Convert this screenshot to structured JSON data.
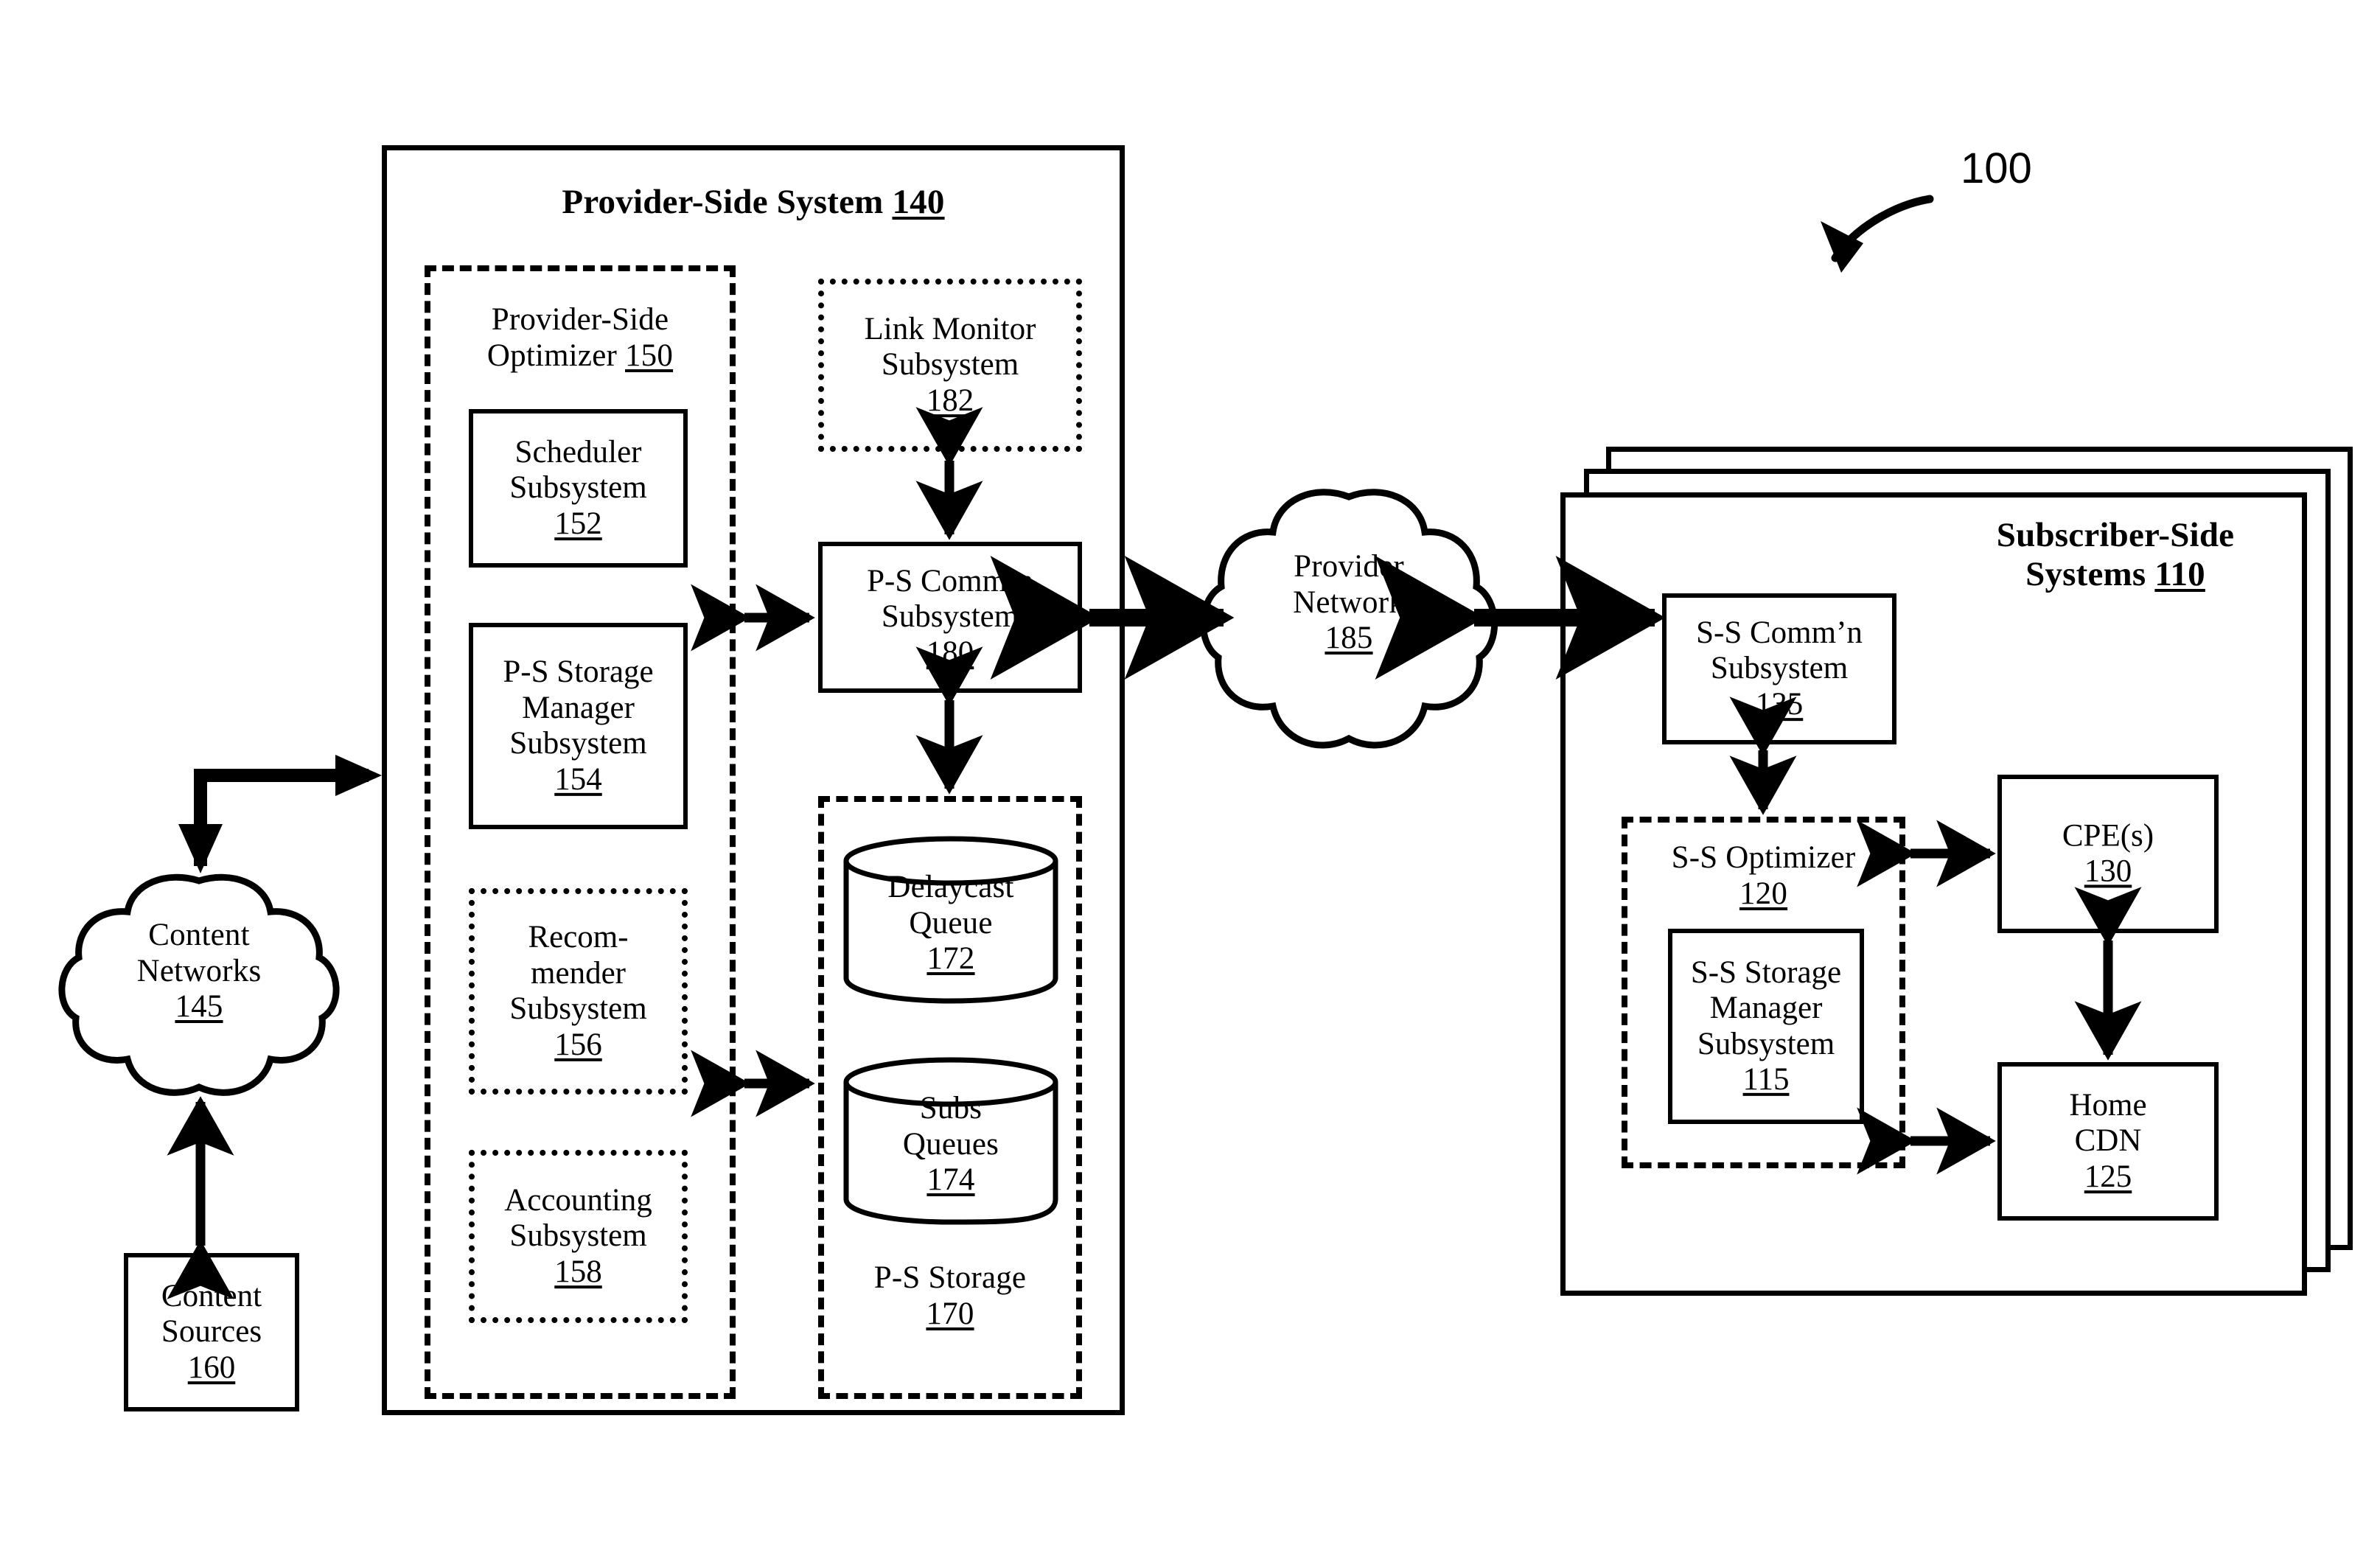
{
  "figure": {
    "reference_number": "100"
  },
  "provider_side_system": {
    "title": "Provider-Side System",
    "ref": "140",
    "optimizer": {
      "title_line1": "Provider-Side",
      "title_line2": "Optimizer",
      "ref": "150",
      "subsystems": [
        {
          "lines": [
            "Scheduler",
            "Subsystem"
          ],
          "ref": "152",
          "border": "solid"
        },
        {
          "lines": [
            "P-S Storage",
            "Manager",
            "Subsystem"
          ],
          "ref": "154",
          "border": "solid"
        },
        {
          "lines": [
            "Recom-",
            "mender",
            "Subsystem"
          ],
          "ref": "156",
          "border": "dotted"
        },
        {
          "lines": [
            "Accounting",
            "Subsystem"
          ],
          "ref": "158",
          "border": "dotted"
        }
      ]
    },
    "link_monitor": {
      "lines": [
        "Link Monitor",
        "Subsystem"
      ],
      "ref": "182"
    },
    "comm_subsystem": {
      "lines": [
        "P-S Comm’n",
        "Subsystem"
      ],
      "ref": "180"
    },
    "storage": {
      "title": "P-S Storage",
      "ref": "170",
      "queues": [
        {
          "lines": [
            "Delaycast",
            "Queue"
          ],
          "ref": "172"
        },
        {
          "lines": [
            "Subs",
            "Queues"
          ],
          "ref": "174"
        }
      ]
    }
  },
  "provider_network": {
    "lines": [
      "Provider",
      "Network"
    ],
    "ref": "185"
  },
  "content_networks": {
    "lines": [
      "Content",
      "Networks"
    ],
    "ref": "145"
  },
  "content_sources": {
    "lines": [
      "Content",
      "Sources"
    ],
    "ref": "160"
  },
  "subscriber_side_systems": {
    "title_line1": "Subscriber-Side",
    "title_line2": "Systems",
    "ref": "110",
    "comm_subsystem": {
      "lines": [
        "S-S Comm’n",
        "Subsystem"
      ],
      "ref": "135"
    },
    "optimizer": {
      "title": "S-S Optimizer",
      "ref": "120",
      "storage_manager": {
        "lines": [
          "S-S Storage",
          "Manager",
          "Subsystem"
        ],
        "ref": "115"
      }
    },
    "cpe": {
      "lines": [
        "CPE(s)"
      ],
      "ref": "130"
    },
    "home_cdn": {
      "lines": [
        "Home",
        "CDN"
      ],
      "ref": "125"
    }
  },
  "colors": {
    "stroke": "#000000",
    "background": "#ffffff"
  }
}
